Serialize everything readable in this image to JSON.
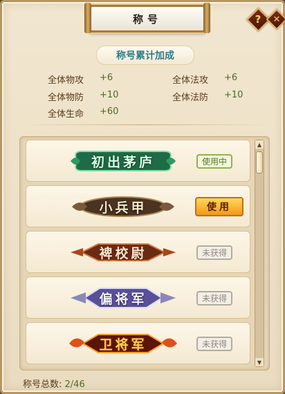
{
  "window": {
    "title": "称号",
    "help_icon": "question-icon",
    "close_icon": "close-icon"
  },
  "bonus": {
    "heading": "称号累计加成",
    "stats": [
      {
        "label": "全体物攻",
        "value": "+6"
      },
      {
        "label": "全体法攻",
        "value": "+6"
      },
      {
        "label": "全体物防",
        "value": "+10"
      },
      {
        "label": "全体法防",
        "value": "+10"
      },
      {
        "label": "全体生命",
        "value": "+60"
      }
    ]
  },
  "titles": [
    {
      "name": "初出茅庐",
      "status": "使用中",
      "state": "in-use",
      "color": "#4fd08a",
      "accent": "#1f7a52"
    },
    {
      "name": "小兵甲",
      "status": "使用",
      "state": "usable",
      "color": "#f6e8c8",
      "accent": "#6b4b2a"
    },
    {
      "name": "裨校尉",
      "status": "未获得",
      "state": "locked",
      "color": "#f1d6c0",
      "accent": "#8a3b1a"
    },
    {
      "name": "偏将军",
      "status": "未获得",
      "state": "locked",
      "color": "#e6e8ff",
      "accent": "#5a4f9a"
    },
    {
      "name": "卫将军",
      "status": "未获得",
      "state": "locked",
      "color": "#ffd34a",
      "accent": "#a5290f"
    }
  ],
  "footer": {
    "label": "称号总数:",
    "count": "2/46"
  }
}
